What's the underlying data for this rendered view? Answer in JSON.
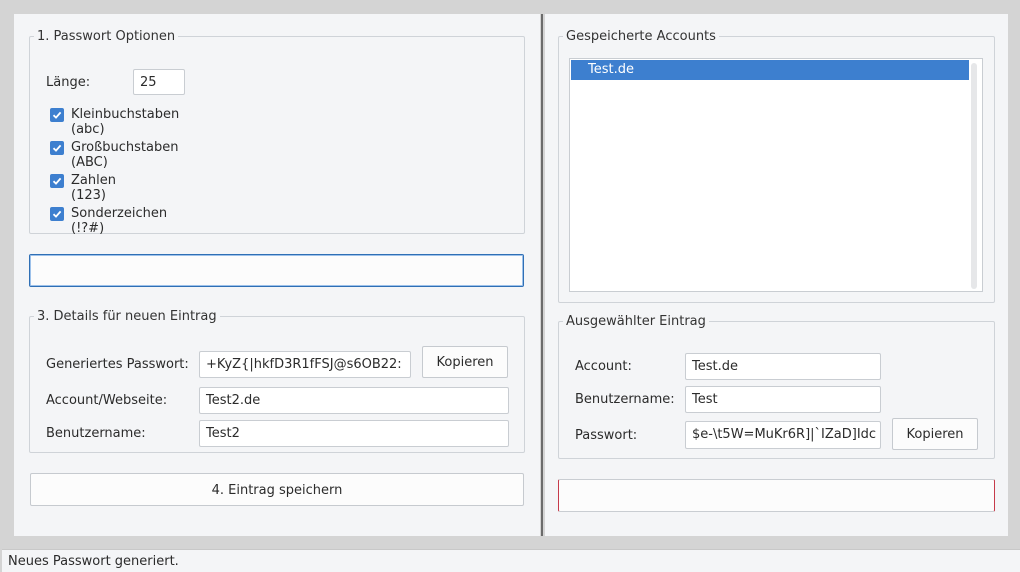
{
  "options": {
    "legend": "1. Passwort Optionen",
    "length_label": "Länge:",
    "length_value": "25",
    "checkboxes": [
      {
        "label": "Kleinbuchstaben (abc)",
        "checked": true
      },
      {
        "label": "Großbuchstaben (ABC)",
        "checked": true
      },
      {
        "label": "Zahlen (123)",
        "checked": true
      },
      {
        "label": "Sonderzeichen (!?#)",
        "checked": true
      }
    ]
  },
  "generate_button": {
    "label": ""
  },
  "details": {
    "legend": "3. Details für neuen Eintrag",
    "generated_label": "Generiertes Passwort:",
    "generated_value": "+KyZ{|hkfD3R1fFSJ@s6OB22:",
    "copy_label": "Kopieren",
    "account_label": "Account/Webseite:",
    "account_value": "Test2.de",
    "username_label": "Benutzername:",
    "username_value": "Test2"
  },
  "save_button": {
    "label": "4. Eintrag speichern"
  },
  "accounts": {
    "legend": "Gespeicherte Accounts",
    "items": [
      "Test.de"
    ],
    "selected_index": 0
  },
  "selected": {
    "legend": "Ausgewählter Eintrag",
    "account_label": "Account:",
    "account_value": "Test.de",
    "username_label": "Benutzername:",
    "username_value": "Test",
    "password_label": "Passwort:",
    "password_value": "$e-\\t5W=MuKr6R]|`IZaD]Idc",
    "copy_label": "Kopieren"
  },
  "delete_button": {
    "label": ""
  },
  "status": {
    "text": "Neues Passwort generiert."
  },
  "colors": {
    "accent": "#3d7fcf",
    "focus_border": "#2f6fb5",
    "danger_border": "#c63a4a"
  }
}
